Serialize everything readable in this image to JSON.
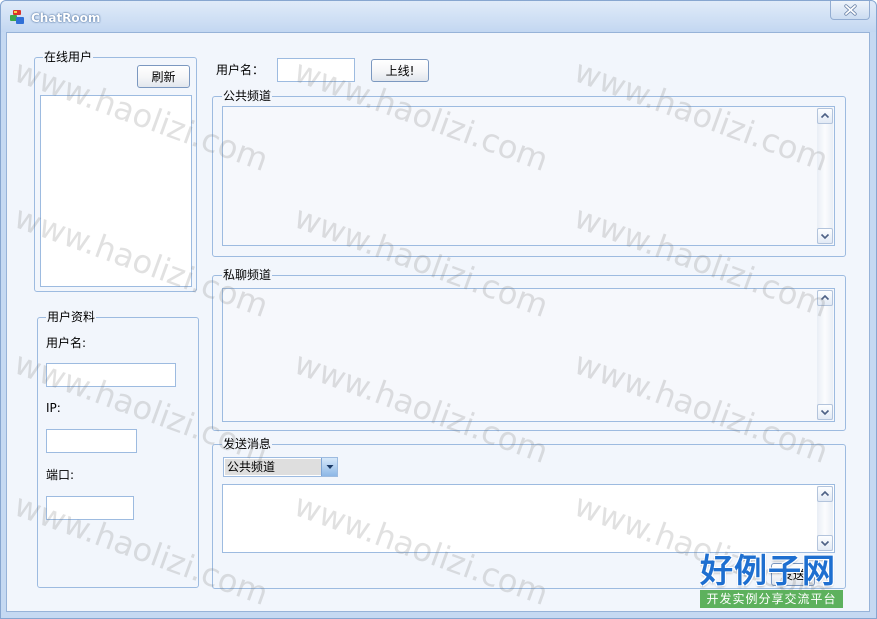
{
  "window": {
    "title": "ChatRoom",
    "app_icon": "chat-app-icon",
    "close_icon": "close-icon"
  },
  "online_users": {
    "group_label": "在线用户",
    "refresh_label": "刷新"
  },
  "profile": {
    "group_label": "用户资料",
    "username_label": "用户名:",
    "username_value": "",
    "ip_label": "IP:",
    "ip_value": "",
    "port_label": "端口:",
    "port_value": ""
  },
  "login": {
    "username_label": "用户名：",
    "username_value": "",
    "go_online_label": "上线!"
  },
  "public_channel": {
    "group_label": "公共频道",
    "content": ""
  },
  "private_channel": {
    "group_label": "私聊频道",
    "content": ""
  },
  "send_message": {
    "group_label": "发送消息",
    "channel_selected": "公共频道",
    "message": "",
    "send_label": "发送"
  },
  "watermark": {
    "text": "www.haolizi.com",
    "logo_title": "好例子网",
    "logo_subtitle": "开发实例分享交流平台"
  },
  "colors": {
    "title_bar": "#c3d7f1",
    "frame": "#c5d9f2",
    "client_background": "#f2f6fc",
    "group_border": "#9dbbe0",
    "logo_blue": "#1e6fd0",
    "logo_green": "#5db15d"
  }
}
